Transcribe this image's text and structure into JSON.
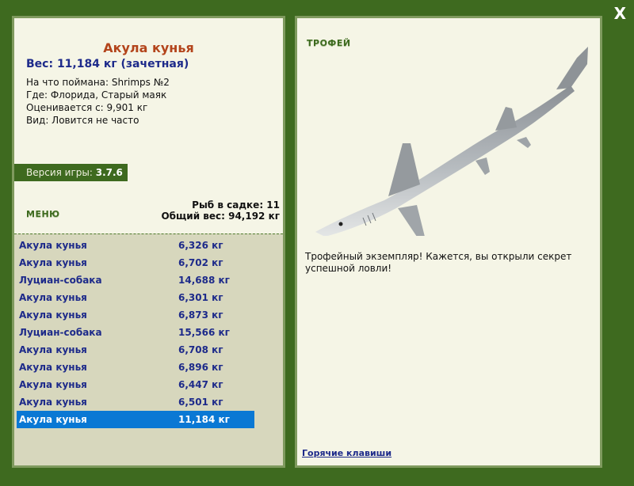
{
  "close_label": "X",
  "fish": {
    "name": "Акула кунья",
    "weight": "Вес: 11,184 кг (зачетная)",
    "bait": "На что поймана: Shrimps №2",
    "location": "Где: Флорида, Старый маяк",
    "valued": "Оценивается с: 9,901 кг",
    "rarity": "Вид: Ловится не часто"
  },
  "version": {
    "label": "Версия игры:",
    "value": "3.7.6"
  },
  "menu_label": "МЕНЮ",
  "net": {
    "count": "Рыб в садке: 11",
    "total": "Общий вес: 94,192 кг"
  },
  "catch_list": [
    {
      "name": "Акула кунья",
      "weight": "6,326 кг"
    },
    {
      "name": "Акула кунья",
      "weight": "6,702 кг"
    },
    {
      "name": "Луциан-собака",
      "weight": "14,688 кг"
    },
    {
      "name": "Акула кунья",
      "weight": "6,301 кг"
    },
    {
      "name": "Акула кунья",
      "weight": "6,873 кг"
    },
    {
      "name": "Луциан-собака",
      "weight": "15,566 кг"
    },
    {
      "name": "Акула кунья",
      "weight": "6,708 кг"
    },
    {
      "name": "Акула кунья",
      "weight": "6,896 кг"
    },
    {
      "name": "Акула кунья",
      "weight": "6,447 кг"
    },
    {
      "name": "Акула кунья",
      "weight": "6,501 кг"
    },
    {
      "name": "Акула кунья",
      "weight": "11,184 кг"
    }
  ],
  "selected_index": 10,
  "trophy_label": "ТРОФЕЙ",
  "trophy_text": "Трофейный экземпляр! Кажется, вы открыли секрет успешной ловли!",
  "hotkeys_label": "Горячие клавиши",
  "colors": {
    "frame": "#3e6a1f",
    "panel": "#f5f5e6",
    "list_bg": "#d7d7bd",
    "selected": "#0a78d4",
    "link": "#1d2a8a",
    "title": "#b3441b"
  }
}
